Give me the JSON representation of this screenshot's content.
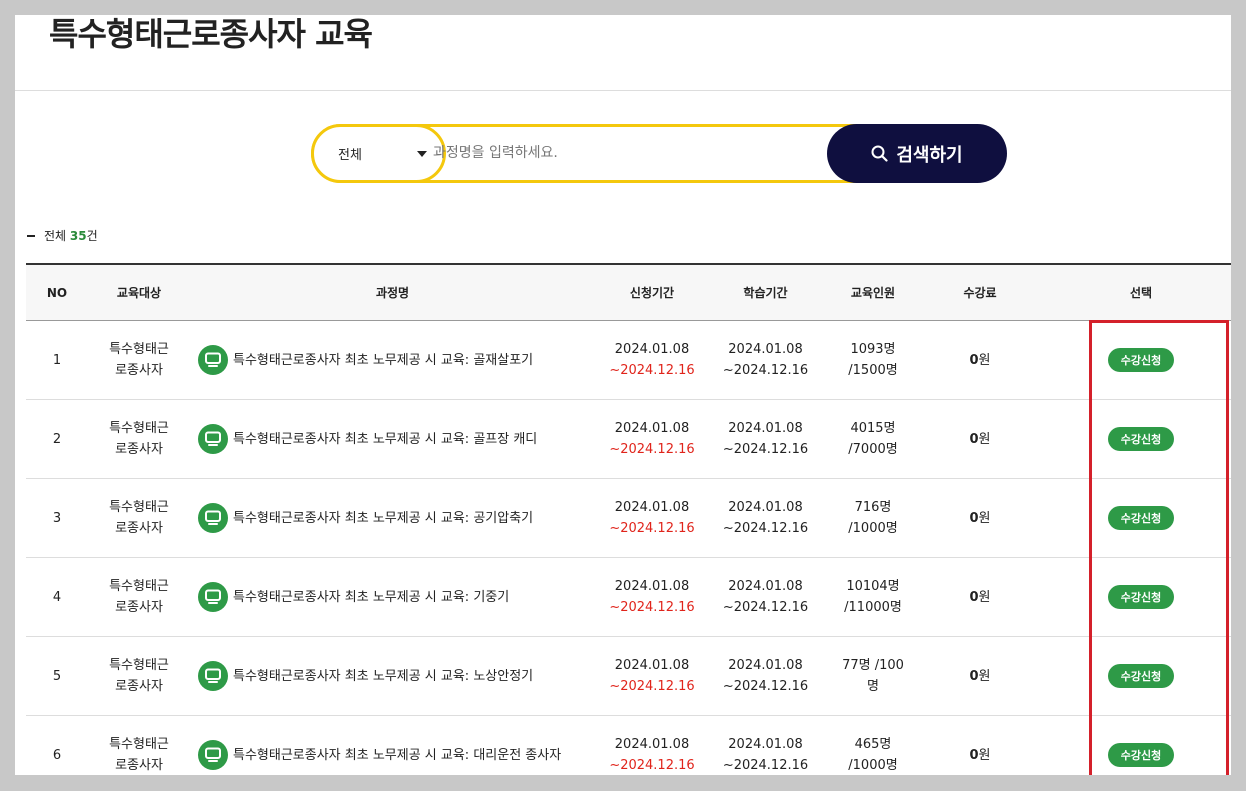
{
  "page": {
    "title": "특수형태근로종사자 교육"
  },
  "search": {
    "category": "전체",
    "placeholder": "과정명을 입력하세요.",
    "button_label": "검색하기"
  },
  "summary": {
    "label": "전체",
    "count": "35",
    "unit": "건"
  },
  "table": {
    "headers": [
      "NO",
      "교육대상",
      "과정명",
      "신청기간",
      "학습기간",
      "교육인원",
      "수강료",
      "선택"
    ],
    "rows": [
      {
        "no": "1",
        "target": "특수형태근로종사자",
        "course": "특수형태근로종사자 최초 노무제공 시 교육: 골재살포기",
        "apply_start": "2024.01.08",
        "apply_end": "~2024.12.16",
        "study_start": "2024.01.08",
        "study_end": "~2024.12.16",
        "people": "1093명 /1500명",
        "fee_num": "0",
        "fee_unit": "원",
        "select_label": "수강신청"
      },
      {
        "no": "2",
        "target": "특수형태근로종사자",
        "course": "특수형태근로종사자 최초 노무제공 시 교육: 골프장 캐디",
        "apply_start": "2024.01.08",
        "apply_end": "~2024.12.16",
        "study_start": "2024.01.08",
        "study_end": "~2024.12.16",
        "people": "4015명 /7000명",
        "fee_num": "0",
        "fee_unit": "원",
        "select_label": "수강신청"
      },
      {
        "no": "3",
        "target": "특수형태근로종사자",
        "course": "특수형태근로종사자 최초 노무제공 시 교육: 공기압축기",
        "apply_start": "2024.01.08",
        "apply_end": "~2024.12.16",
        "study_start": "2024.01.08",
        "study_end": "~2024.12.16",
        "people": "716명 /1000명",
        "fee_num": "0",
        "fee_unit": "원",
        "select_label": "수강신청"
      },
      {
        "no": "4",
        "target": "특수형태근로종사자",
        "course": "특수형태근로종사자 최초 노무제공 시 교육: 기중기",
        "apply_start": "2024.01.08",
        "apply_end": "~2024.12.16",
        "study_start": "2024.01.08",
        "study_end": "~2024.12.16",
        "people": "10104명 /11000명",
        "fee_num": "0",
        "fee_unit": "원",
        "select_label": "수강신청"
      },
      {
        "no": "5",
        "target": "특수형태근로종사자",
        "course": "특수형태근로종사자 최초 노무제공 시 교육: 노상안정기",
        "apply_start": "2024.01.08",
        "apply_end": "~2024.12.16",
        "study_start": "2024.01.08",
        "study_end": "~2024.12.16",
        "people": "77명 /100명",
        "fee_num": "0",
        "fee_unit": "원",
        "select_label": "수강신청"
      },
      {
        "no": "6",
        "target": "특수형태근로종사자",
        "course": "특수형태근로종사자 최초 노무제공 시 교육: 대리운전 종사자",
        "apply_start": "2024.01.08",
        "apply_end": "~2024.12.16",
        "study_start": "2024.01.08",
        "study_end": "~2024.12.16",
        "people": "465명 /1000명",
        "fee_num": "0",
        "fee_unit": "원",
        "select_label": "수강신청"
      }
    ]
  },
  "colors": {
    "accent_yellow": "#f4c80d",
    "navy": "#0f0f3f",
    "green": "#2e9a47",
    "red": "#e0241b",
    "highlight_red": "#d4202a"
  }
}
